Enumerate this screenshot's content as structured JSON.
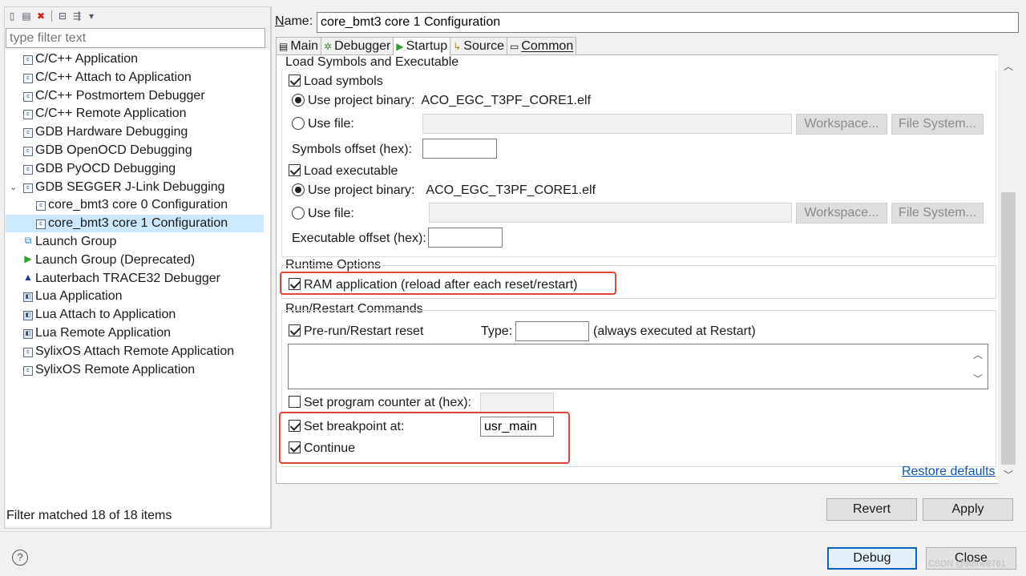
{
  "left": {
    "filter_placeholder": "type filter text",
    "tree": [
      {
        "label": "C/C++ Application",
        "icon": "c-launch-icon"
      },
      {
        "label": "C/C++ Attach to Application",
        "icon": "c-launch-icon"
      },
      {
        "label": "C/C++ Postmortem Debugger",
        "icon": "c-launch-icon"
      },
      {
        "label": "C/C++ Remote Application",
        "icon": "c-launch-icon"
      },
      {
        "label": "GDB Hardware Debugging",
        "icon": "c-launch-icon"
      },
      {
        "label": "GDB OpenOCD Debugging",
        "icon": "c-launch-icon"
      },
      {
        "label": "GDB PyOCD Debugging",
        "icon": "c-launch-icon"
      },
      {
        "label": "GDB SEGGER J-Link Debugging",
        "icon": "c-launch-icon",
        "expanded": true
      },
      {
        "label": "core_bmt3 core 0 Configuration",
        "icon": "c-launch-icon",
        "child": true
      },
      {
        "label": "core_bmt3 core 1 Configuration",
        "icon": "c-launch-icon",
        "child": true,
        "selected": true
      },
      {
        "label": "Launch Group",
        "icon": "launch-group-icon"
      },
      {
        "label": "Launch Group (Deprecated)",
        "icon": "launch-group-deprecated-icon"
      },
      {
        "label": "Lauterbach TRACE32 Debugger",
        "icon": "lauterbach-icon"
      },
      {
        "label": "Lua Application",
        "icon": "lua-icon"
      },
      {
        "label": "Lua Attach to Application",
        "icon": "lua-attach-icon"
      },
      {
        "label": "Lua Remote Application",
        "icon": "lua-remote-icon"
      },
      {
        "label": "SylixOS Attach Remote Application",
        "icon": "c-launch-icon"
      },
      {
        "label": "SylixOS Remote Application",
        "icon": "c-launch-icon"
      }
    ],
    "filter_status": "Filter matched 18 of 18 items"
  },
  "right": {
    "name_label_mnemonic": "N",
    "name_label_rest": "ame:",
    "name_value": "core_bmt3 core 1 Configuration",
    "tabs": [
      {
        "label": "Main",
        "icon": "main-tab-icon"
      },
      {
        "label": "Debugger",
        "icon": "debugger-tab-icon"
      },
      {
        "label": "Startup",
        "icon": "startup-tab-icon",
        "active": true
      },
      {
        "label": "Source",
        "icon": "source-tab-icon"
      },
      {
        "label": "Common",
        "icon": "common-tab-icon"
      }
    ],
    "load_group": {
      "title": "Load Symbols and Executable",
      "load_symbols": "Load symbols",
      "use_project_binary": "Use project binary:",
      "symbols_binary": "ACO_EGC_T3PF_CORE1.elf",
      "use_file": "Use file:",
      "workspace": "Workspace...",
      "file_system": "File System...",
      "symbols_offset": "Symbols offset (hex):",
      "load_executable": "Load executable",
      "executable_binary": "ACO_EGC_T3PF_CORE1.elf",
      "executable_offset": "Executable offset (hex):"
    },
    "runtime_group": {
      "title": "Runtime Options",
      "ram_application": "RAM application (reload after each reset/restart)"
    },
    "run_group": {
      "title": "Run/Restart Commands",
      "pre_run": "Pre-run/Restart reset",
      "type_label": "Type:",
      "type_hint": "(always executed at Restart)",
      "set_pc": "Set program counter at (hex):",
      "set_breakpoint": "Set breakpoint at:",
      "breakpoint_value": "usr_main",
      "continue": "Continue"
    },
    "restore_defaults": "Restore defaults",
    "revert_label": "Revert",
    "apply_label": "Apply"
  },
  "footer": {
    "debug_label": "Debug",
    "close_label": "Close",
    "watermark": "CSDN @stone8761"
  },
  "colors": {
    "selection": "#cce8ff",
    "highlight_box": "#e0443a",
    "link": "#0a56b6",
    "default_button_border": "#0a64c8"
  }
}
